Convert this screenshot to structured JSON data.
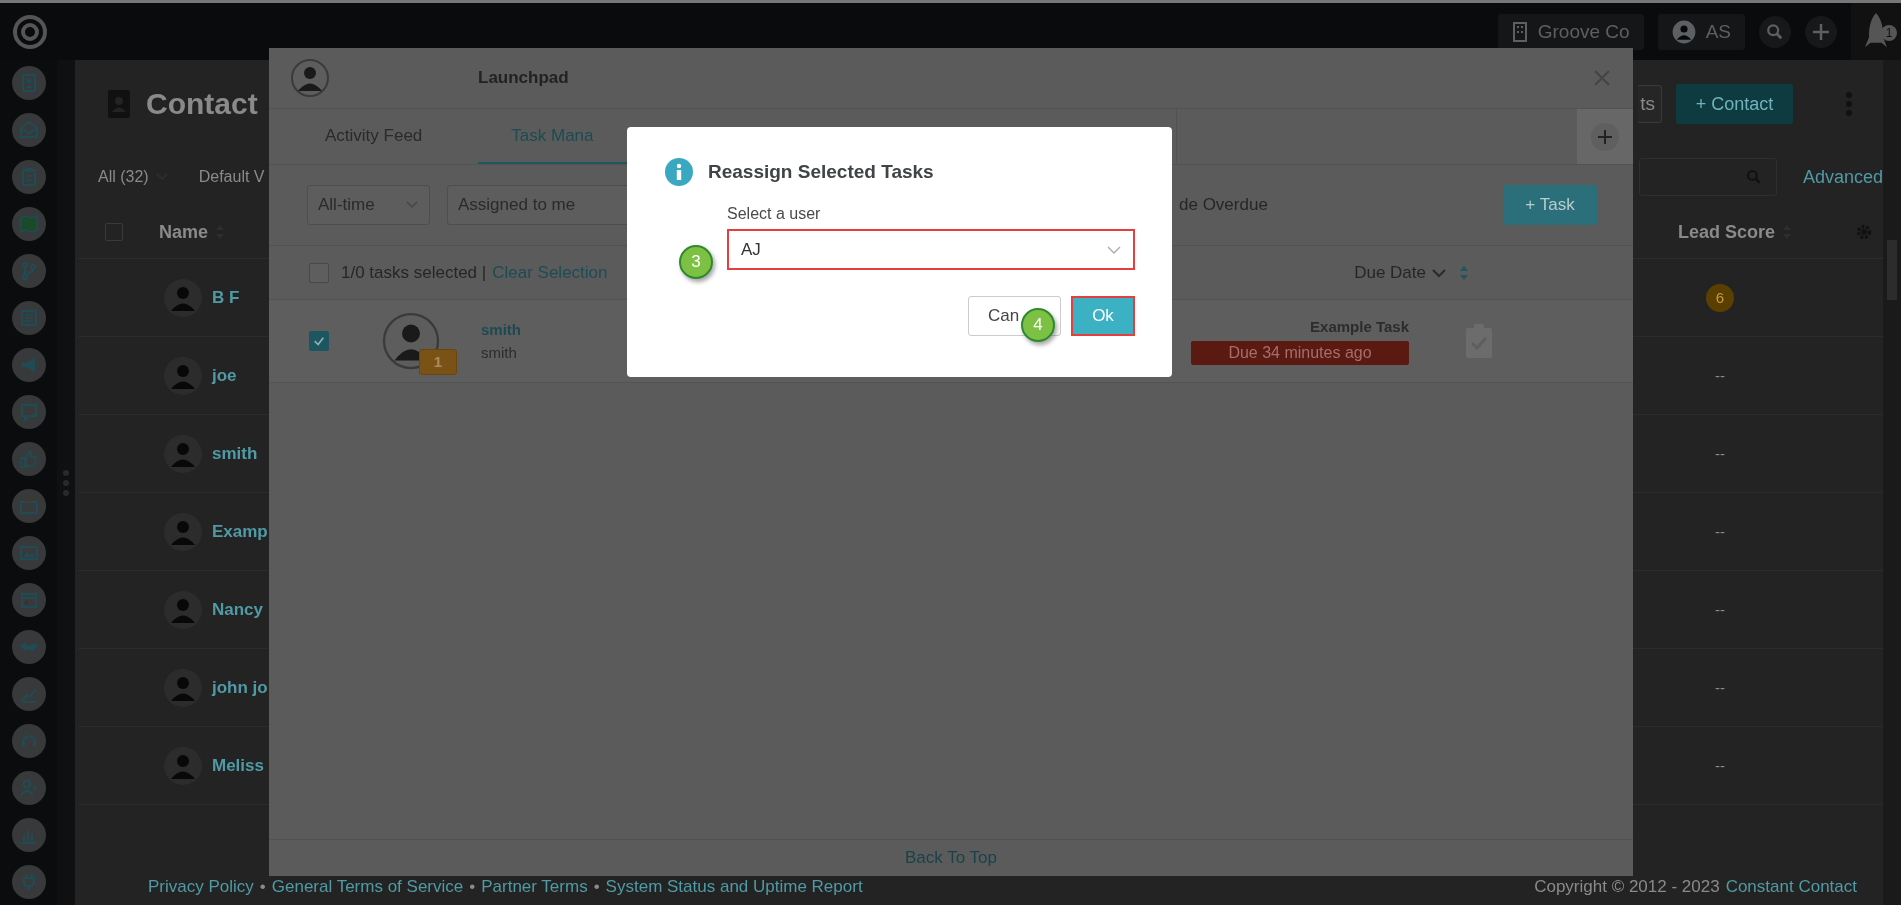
{
  "topbar": {
    "company": "Groove Co",
    "user": "AS",
    "notification_count": "1"
  },
  "page": {
    "select_all_checked": false,
    "title": "Contact",
    "filter": "All (32)",
    "view": "Default V",
    "header_button": "ts",
    "add_button": "+ Contact",
    "advanced_link": "Advanced",
    "columns": [
      {
        "label": "Name"
      },
      {
        "label": "Lead Score"
      }
    ],
    "rows": [
      {
        "name": "B F",
        "lead_score": "6",
        "kind": "badge"
      },
      {
        "name": "joe",
        "lead_score": "--",
        "kind": "plain"
      },
      {
        "name": "smith",
        "lead_score": "--",
        "kind": "plain"
      },
      {
        "name": "Examp",
        "lead_score": "--",
        "kind": "plain"
      },
      {
        "name": "Nancy",
        "lead_score": "--",
        "kind": "plain"
      },
      {
        "name": "john jo",
        "lead_score": "--",
        "kind": "plain"
      },
      {
        "name": "Meliss",
        "lead_score": "--",
        "kind": "plain"
      }
    ]
  },
  "footer": {
    "separator": "•",
    "links": [
      "Privacy Policy",
      "General Terms of Service",
      "Partner Terms",
      "System Status and Uptime Report"
    ],
    "copyright": "Copyright © 2012 - 2023",
    "copyright_link": "Constant Contact"
  },
  "launchpad": {
    "title": "Launchpad",
    "tabs": [
      {
        "label": "Activity Feed",
        "selected": false
      },
      {
        "label": "Task Mana",
        "selected": true
      }
    ],
    "period": "All-time",
    "assignee": "Assigned to me",
    "overdue_label": "de Overdue",
    "add_task": "+ Task",
    "selection": {
      "checked": false,
      "text": "1/0 tasks selected |",
      "clear": "Clear Selection"
    },
    "due_column": "Due Date",
    "tasks": [
      {
        "checked": true,
        "badge": "1",
        "name": "smith",
        "subtitle": "smith",
        "title": "Example Task",
        "due": "Due 34 minutes ago"
      }
    ],
    "back_to_top": "Back To Top"
  },
  "dialog": {
    "title": "Reassign Selected Tasks",
    "label": "Select a user",
    "value": "AJ",
    "cancel": "Can",
    "ok": "Ok",
    "steps": [
      "3",
      "4"
    ]
  }
}
